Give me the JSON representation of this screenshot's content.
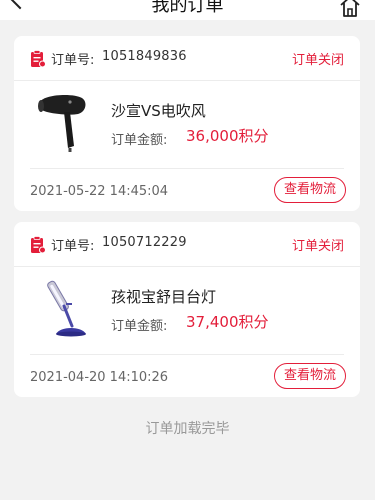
{
  "header": {
    "title": "我的订单"
  },
  "orders": [
    {
      "order_label": "订单号:",
      "order_no": "1051849836",
      "status": "订单关闭",
      "product_name": "沙宣VS电吹风",
      "amount_label": "订单金额:",
      "amount": "36,000积分",
      "time": "2021-05-22 14:45:04",
      "logistics_label": "查看物流",
      "product_icon": "hair-dryer-image"
    },
    {
      "order_label": "订单号:",
      "order_no": "1050712229",
      "status": "订单关闭",
      "product_name": "孩视宝舒目台灯",
      "amount_label": "订单金额:",
      "amount": "37,400积分",
      "time": "2021-04-20 14:10:26",
      "logistics_label": "查看物流",
      "product_icon": "desk-lamp-image"
    }
  ],
  "footer": {
    "text": "订单加载完毕"
  },
  "colors": {
    "accent": "#e31e3a",
    "background": "#f2f2f2",
    "card": "#ffffff"
  }
}
